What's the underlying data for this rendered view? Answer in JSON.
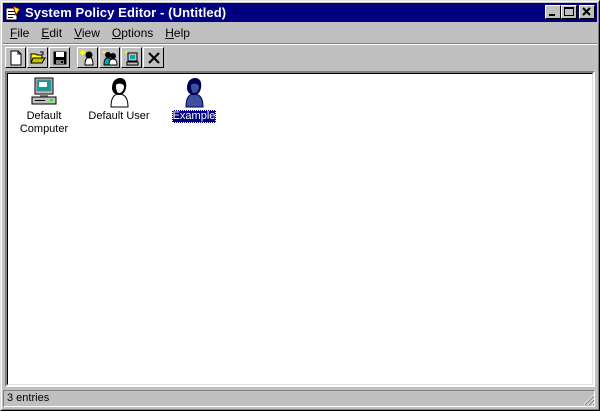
{
  "window": {
    "title": "System Policy Editor - (Untitled)"
  },
  "menu": [
    {
      "key": "F",
      "rest": "ile"
    },
    {
      "key": "E",
      "rest": "dit"
    },
    {
      "key": "V",
      "rest": "iew"
    },
    {
      "key": "O",
      "rest": "ptions"
    },
    {
      "key": "H",
      "rest": "elp"
    }
  ],
  "items": [
    {
      "label_line1": "Default",
      "label_line2": "Computer",
      "icon": "computer-icon"
    },
    {
      "label": "Default User",
      "icon": "user-icon"
    },
    {
      "label": "Example",
      "icon": "user-icon",
      "selected": true
    }
  ],
  "status": {
    "text": "3 entries"
  },
  "colors": {
    "titlebar": "#000080",
    "selection": "#000080",
    "face": "#c0c0c0"
  }
}
